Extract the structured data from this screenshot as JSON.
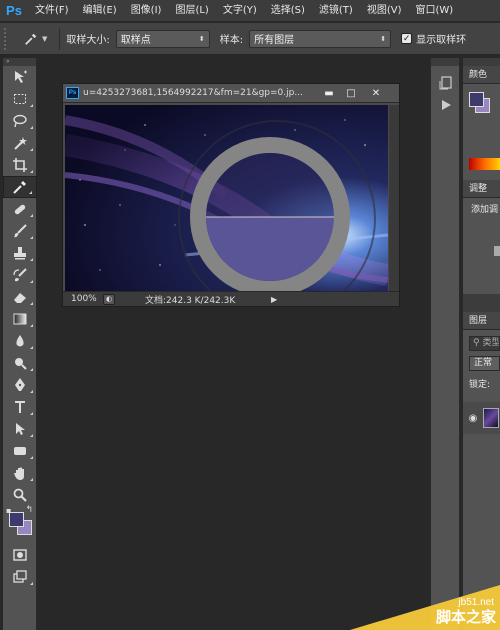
{
  "app": {
    "logo": "Ps"
  },
  "menu": [
    {
      "label": "文件(F)"
    },
    {
      "label": "编辑(E)"
    },
    {
      "label": "图像(I)"
    },
    {
      "label": "图层(L)"
    },
    {
      "label": "文字(Y)"
    },
    {
      "label": "选择(S)"
    },
    {
      "label": "滤镜(T)"
    },
    {
      "label": "视图(V)"
    },
    {
      "label": "窗口(W)"
    }
  ],
  "options": {
    "sample_size_label": "取样大小:",
    "sample_size_value": "取样点",
    "sample_label": "样本:",
    "sample_value": "所有图层",
    "show_ring_label": "显示取样环",
    "show_ring_checked": true
  },
  "toolbar": {
    "foreground_color": "#3e3a6e",
    "background_color": "#9886c0"
  },
  "document": {
    "title": "u=4253273681,1564992217&fm=21&gp=0.jp...",
    "zoom": "100%",
    "doc_size": "文档:242.3 K/242.3K",
    "win_minimize": "▬",
    "win_maximize": "□",
    "win_close": "✕",
    "sample_ring_top_color": "#2a2658",
    "sample_ring_bottom_color": "#5a5597",
    "ring_color": "#808080"
  },
  "panels": {
    "color_tab": "颜色",
    "adjust_tab": "调整",
    "adjust_text": "添加调",
    "layers_tab": "图层",
    "search_placeholder": "类型",
    "blend_mode": "正常",
    "lock_label": "锁定:"
  },
  "watermark": {
    "url": "jb51.net",
    "site": "脚本之家"
  }
}
